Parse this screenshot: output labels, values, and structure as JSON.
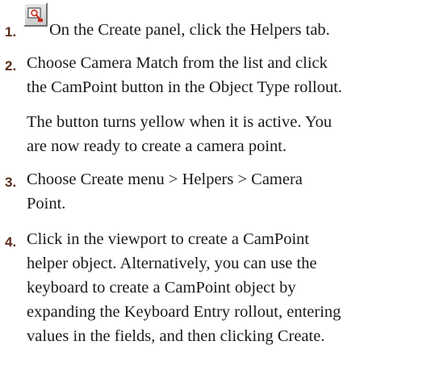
{
  "steps": [
    {
      "number": "1.",
      "icon": "helpers-tab-icon",
      "lines": [
        "On the Create panel, click the Helpers tab."
      ]
    },
    {
      "number": "2.",
      "lines": [
        "Choose Camera Match from the list and click",
        "the CamPoint button in the Object Type rollout."
      ]
    },
    {
      "note_lines": [
        "The button turns yellow when it is active.  You",
        "are now ready to create a camera point."
      ]
    },
    {
      "number": "3.",
      "lines": [
        "Choose Create menu > Helpers > Camera",
        "Point."
      ]
    },
    {
      "number": "4.",
      "lines": [
        "Click in the viewport to create a CamPoint",
        "helper object. Alternatively, you can use the",
        "keyboard to create a CamPoint object by",
        "expanding the Keyboard Entry rollout, entering",
        "values in the fields, and then clicking Create."
      ]
    }
  ],
  "colors": {
    "step_number": "#5a2d1a",
    "icon_accent": "#c8281e"
  }
}
